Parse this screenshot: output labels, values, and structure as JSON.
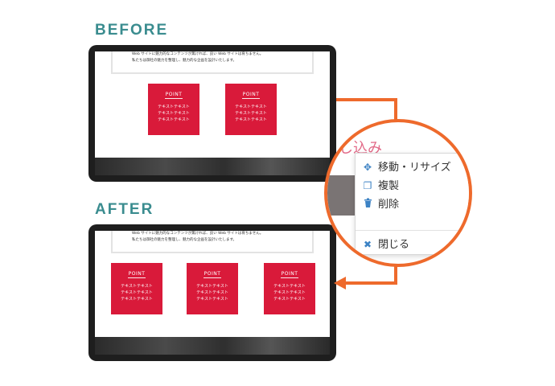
{
  "labels": {
    "before": "BEFORE",
    "after": "AFTER"
  },
  "textbox": {
    "line1": "Web サイトに魅力的なコンテンツが無ければ、良い Web サイトは育ちません。",
    "line2": "私たちは御社の魅力を整理し、魅力的な企画を設計いたします。"
  },
  "point_title": "POINT",
  "point_lines": [
    "テキストテキスト",
    "テキストテキスト",
    "テキストテキスト"
  ],
  "zoom": {
    "behind_text": "し込み",
    "menu": {
      "move_resize": "移動・リサイズ",
      "duplicate": "複製",
      "delete": "削除",
      "close": "閉じる"
    }
  },
  "colors": {
    "label": "#3a8c8f",
    "point_bg": "#d91a3a",
    "accent": "#ee6a2c",
    "icon_blue": "#3c82c4"
  },
  "icons": [
    "move-arrows-icon",
    "duplicate-icon",
    "trash-icon",
    "close-x-icon"
  ]
}
